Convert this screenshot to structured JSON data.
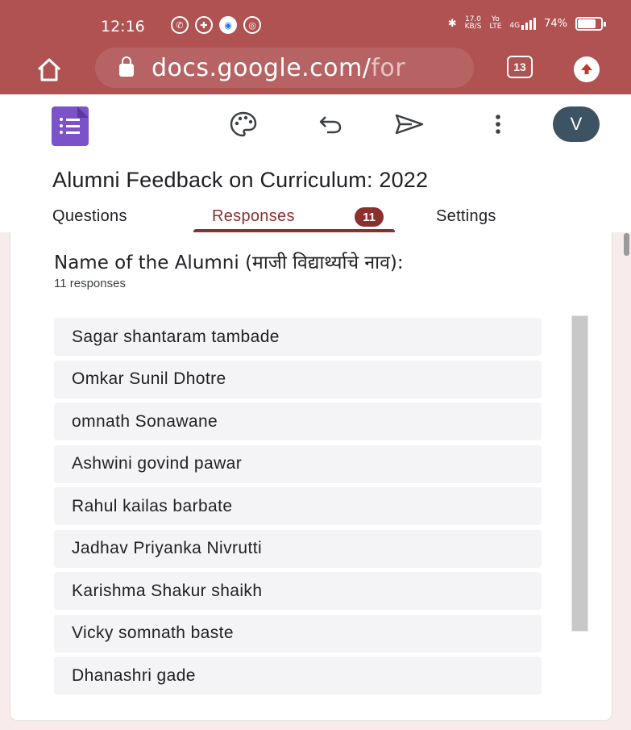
{
  "status_bar": {
    "time": "12:16",
    "network_speed_value": "17.0",
    "network_speed_unit": "KB/S",
    "volte_top": "Yo",
    "volte_bottom": "LTE",
    "signal_label": "4G",
    "battery_percent": "74%"
  },
  "browser": {
    "url_main": "docs.google.com/",
    "url_faded": "for",
    "tab_count": "13"
  },
  "form": {
    "title": "Alumni Feedback on Curriculum: 2022",
    "tabs": [
      {
        "label": "Questions"
      },
      {
        "label": "Responses"
      },
      {
        "label": "Settings"
      }
    ],
    "responses_badge": "11",
    "active_tab": "Responses"
  },
  "user": {
    "avatar_initial": "V"
  },
  "question": {
    "title": "Name of the Alumni (माजी विद्यार्थ्याचे नाव):",
    "response_count": "11 responses",
    "responses": [
      "Sagar shantaram tambade",
      "Omkar Sunil Dhotre",
      "omnath Sonawane",
      "Ashwini govind pawar",
      "Rahul kailas barbate",
      "Jadhav Priyanka Nivrutti",
      "Karishma Shakur shaikh",
      "Vicky somnath baste",
      "Dhanashri gade"
    ]
  },
  "colors": {
    "browser_bar": "#b05252",
    "accent": "#8b2f2f",
    "forms_purple": "#7b52c8",
    "avatar_bg": "#3c5363"
  },
  "icons": {
    "home": "home-icon",
    "lock": "lock-icon",
    "update": "update-icon",
    "palette": "palette-icon",
    "undo": "undo-icon",
    "send": "send-icon",
    "more": "more-vertical-icon"
  }
}
